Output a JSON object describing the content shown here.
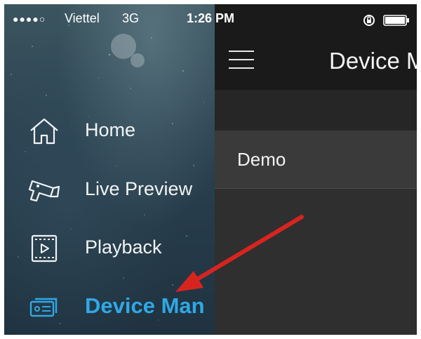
{
  "status_bar": {
    "signal": "●●●●○",
    "carrier": "Viettel",
    "network": "3G",
    "time": "1:26 PM"
  },
  "sidebar": {
    "items": [
      {
        "label": "Home",
        "icon": "home-icon"
      },
      {
        "label": "Live Preview",
        "icon": "camera-icon"
      },
      {
        "label": "Playback",
        "icon": "playback-icon"
      },
      {
        "label": "Device Man",
        "icon": "device-icon",
        "active": true
      }
    ]
  },
  "header": {
    "title": "Device M"
  },
  "devices": [
    {
      "name": "Demo"
    }
  ],
  "colors": {
    "accent": "#2fa8e6",
    "annotation_arrow": "#d8241f"
  }
}
